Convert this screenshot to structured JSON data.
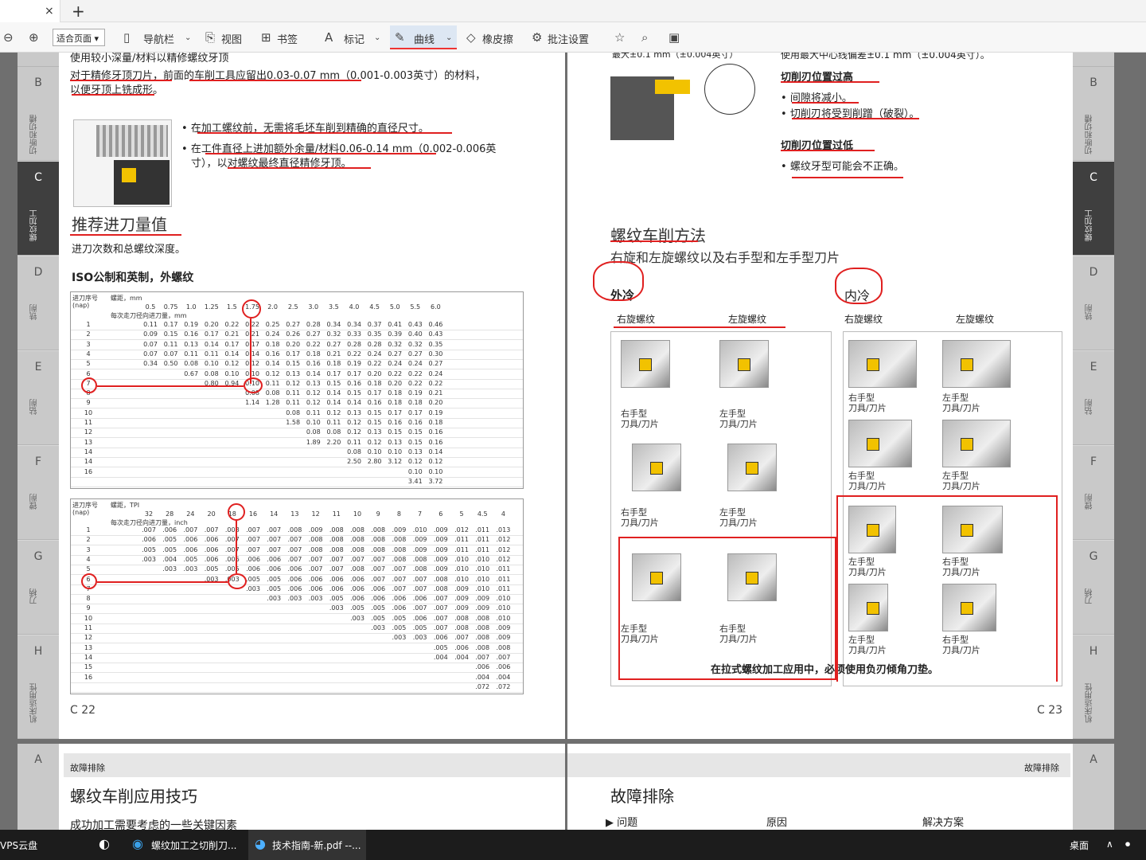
{
  "tab": {
    "close": "×",
    "new": "+"
  },
  "toolbar": {
    "zoom_out": "⊖",
    "zoom_in": "⊕",
    "zoom": "适合页面",
    "nav": "导航栏",
    "view": "视图",
    "bookmark": "书签",
    "mark": "标记",
    "curve": "曲线",
    "eraser": "橡皮擦",
    "annot": "批注设置"
  },
  "left": {
    "l1": "使用较小深量/材料以精修螺纹牙顶",
    "l2": "对于精修牙顶刀片，前面的车削工具应留出0.03-0.07 mm（0.001-0.003英寸）的材料，",
    "l3": "以便牙顶上铣成形。",
    "b1": "在加工螺纹前，无需将毛坯车削到精确的直径尺寸。",
    "b2": "在工件直径上进加额外余量/材料0.06-0.14 mm（0.002-0.006英",
    "b2b": "寸），以对螺纹最终直径精修牙顶。",
    "h1": "推荐进刀量值",
    "h1s": "进刀次数和总螺纹深度。",
    "h2": "ISO公制和英制，外螺纹",
    "t1_label": "进刀序号",
    "t1_nap": "(nap)",
    "t1_pitch": "螺距，mm",
    "t1_sub": "每次走刀径向进刀量，mm",
    "t1_cols": [
      "0.5",
      "0.75",
      "1.0",
      "1.25",
      "1.5",
      "1.75",
      "2.0",
      "2.5",
      "3.0",
      "3.5",
      "4.0",
      "4.5",
      "5.0",
      "5.5",
      "6.0"
    ],
    "t1_rows": [
      [
        "1",
        "0.11",
        "0.17",
        "0.19",
        "0.20",
        "0.22",
        "0.22",
        "0.25",
        "0.27",
        "0.28",
        "0.34",
        "0.34",
        "0.37",
        "0.41",
        "0.43",
        "0.46"
      ],
      [
        "2",
        "0.09",
        "0.15",
        "0.16",
        "0.17",
        "0.21",
        "0.21",
        "0.24",
        "0.26",
        "0.27",
        "0.32",
        "0.33",
        "0.35",
        "0.39",
        "0.40",
        "0.43"
      ],
      [
        "3",
        "0.07",
        "0.11",
        "0.13",
        "0.14",
        "0.17",
        "0.17",
        "0.18",
        "0.20",
        "0.22",
        "0.27",
        "0.28",
        "0.28",
        "0.32",
        "0.32",
        "0.35"
      ],
      [
        "4",
        "0.07",
        "0.07",
        "0.11",
        "0.11",
        "0.14",
        "0.14",
        "0.16",
        "0.17",
        "0.18",
        "0.21",
        "0.22",
        "0.24",
        "0.27",
        "0.27",
        "0.30"
      ],
      [
        "5",
        "0.34",
        "0.50",
        "0.08",
        "0.10",
        "0.12",
        "0.12",
        "0.14",
        "0.15",
        "0.16",
        "0.18",
        "0.19",
        "0.22",
        "0.24",
        "0.24",
        "0.27"
      ],
      [
        "6",
        "",
        "",
        "0.67",
        "0.08",
        "0.10",
        "0.10",
        "0.12",
        "0.13",
        "0.14",
        "0.17",
        "0.17",
        "0.20",
        "0.22",
        "0.22",
        "0.24"
      ],
      [
        "7",
        "",
        "",
        "",
        "0.80",
        "0.94",
        "0.10",
        "0.11",
        "0.12",
        "0.13",
        "0.15",
        "0.16",
        "0.18",
        "0.20",
        "0.22",
        "0.22"
      ],
      [
        "8",
        "",
        "",
        "",
        "",
        "",
        "0.08",
        "0.08",
        "0.11",
        "0.12",
        "0.14",
        "0.15",
        "0.17",
        "0.18",
        "0.19",
        "0.21"
      ],
      [
        "9",
        "",
        "",
        "",
        "",
        "",
        "1.14",
        "1.28",
        "0.11",
        "0.12",
        "0.14",
        "0.14",
        "0.16",
        "0.18",
        "0.18",
        "0.20"
      ],
      [
        "10",
        "",
        "",
        "",
        "",
        "",
        "",
        "",
        "0.08",
        "0.11",
        "0.12",
        "0.13",
        "0.15",
        "0.17",
        "0.17",
        "0.19"
      ],
      [
        "11",
        "",
        "",
        "",
        "",
        "",
        "",
        "",
        "1.58",
        "0.10",
        "0.11",
        "0.12",
        "0.15",
        "0.16",
        "0.16",
        "0.18"
      ],
      [
        "12",
        "",
        "",
        "",
        "",
        "",
        "",
        "",
        "",
        "0.08",
        "0.08",
        "0.12",
        "0.13",
        "0.15",
        "0.15",
        "0.16"
      ],
      [
        "13",
        "",
        "",
        "",
        "",
        "",
        "",
        "",
        "",
        "1.89",
        "2.20",
        "0.11",
        "0.12",
        "0.13",
        "0.15",
        "0.16"
      ],
      [
        "14",
        "",
        "",
        "",
        "",
        "",
        "",
        "",
        "",
        "",
        "",
        "0.08",
        "0.10",
        "0.10",
        "0.13",
        "0.14"
      ],
      [
        "14",
        "",
        "",
        "",
        "",
        "",
        "",
        "",
        "",
        "",
        "",
        "2.50",
        "2.80",
        "3.12",
        "0.12",
        "0.12"
      ],
      [
        "16",
        "",
        "",
        "",
        "",
        "",
        "",
        "",
        "",
        "",
        "",
        "",
        "",
        "",
        "0.10",
        "0.10"
      ],
      [
        "",
        "",
        "",
        "",
        "",
        "",
        "",
        "",
        "",
        "",
        "",
        "",
        "",
        "",
        "3.41",
        "3.72"
      ]
    ],
    "t2_pitch": "螺距，TPI",
    "t2_sub": "每次走刀径向进刀量，inch",
    "t2_cols": [
      "32",
      "28",
      "24",
      "20",
      "18",
      "16",
      "14",
      "13",
      "12",
      "11",
      "10",
      "9",
      "8",
      "7",
      "6",
      "5",
      "4.5",
      "4"
    ],
    "t2_rows": [
      [
        "1",
        ".007",
        ".006",
        ".007",
        ".007",
        ".008",
        ".007",
        ".007",
        ".008",
        ".009",
        ".008",
        ".008",
        ".008",
        ".009",
        ".010",
        ".009",
        ".012",
        ".011",
        ".013"
      ],
      [
        "2",
        ".006",
        ".005",
        ".006",
        ".006",
        ".007",
        ".007",
        ".007",
        ".007",
        ".008",
        ".008",
        ".008",
        ".008",
        ".008",
        ".009",
        ".009",
        ".011",
        ".011",
        ".012"
      ],
      [
        "3",
        ".005",
        ".005",
        ".006",
        ".006",
        ".007",
        ".007",
        ".007",
        ".007",
        ".008",
        ".008",
        ".008",
        ".008",
        ".008",
        ".009",
        ".009",
        ".011",
        ".011",
        ".012"
      ],
      [
        "4",
        ".003",
        ".004",
        ".005",
        ".006",
        ".006",
        ".006",
        ".006",
        ".007",
        ".007",
        ".007",
        ".007",
        ".007",
        ".008",
        ".008",
        ".009",
        ".010",
        ".010",
        ".012"
      ],
      [
        "5",
        "",
        ".003",
        ".003",
        ".005",
        ".005",
        ".006",
        ".006",
        ".006",
        ".007",
        ".007",
        ".008",
        ".007",
        ".007",
        ".008",
        ".009",
        ".010",
        ".010",
        ".011"
      ],
      [
        "6",
        "",
        "",
        "",
        ".003",
        ".003",
        ".005",
        ".005",
        ".006",
        ".006",
        ".006",
        ".006",
        ".007",
        ".007",
        ".007",
        ".008",
        ".010",
        ".010",
        ".011"
      ],
      [
        "7",
        "",
        "",
        "",
        "",
        "",
        ".003",
        ".005",
        ".006",
        ".006",
        ".006",
        ".006",
        ".006",
        ".007",
        ".007",
        ".008",
        ".009",
        ".010",
        ".011"
      ],
      [
        "8",
        "",
        "",
        "",
        "",
        "",
        "",
        ".003",
        ".003",
        ".003",
        ".005",
        ".006",
        ".006",
        ".006",
        ".006",
        ".007",
        ".009",
        ".009",
        ".010"
      ],
      [
        "9",
        "",
        "",
        "",
        "",
        "",
        "",
        "",
        "",
        "",
        ".003",
        ".005",
        ".005",
        ".006",
        ".007",
        ".007",
        ".009",
        ".009",
        ".010"
      ],
      [
        "10",
        "",
        "",
        "",
        "",
        "",
        "",
        "",
        "",
        "",
        "",
        ".003",
        ".005",
        ".005",
        ".006",
        ".007",
        ".008",
        ".008",
        ".010"
      ],
      [
        "11",
        "",
        "",
        "",
        "",
        "",
        "",
        "",
        "",
        "",
        "",
        "",
        ".003",
        ".005",
        ".005",
        ".007",
        ".008",
        ".008",
        ".009"
      ],
      [
        "12",
        "",
        "",
        "",
        "",
        "",
        "",
        "",
        "",
        "",
        "",
        "",
        "",
        ".003",
        ".003",
        ".006",
        ".007",
        ".008",
        ".009"
      ],
      [
        "13",
        "",
        "",
        "",
        "",
        "",
        "",
        "",
        "",
        "",
        "",
        "",
        "",
        "",
        "",
        ".005",
        ".006",
        ".008",
        ".008"
      ],
      [
        "14",
        "",
        "",
        "",
        "",
        "",
        "",
        "",
        "",
        "",
        "",
        "",
        "",
        "",
        "",
        ".004",
        ".004",
        ".007",
        ".007"
      ],
      [
        "15",
        "",
        "",
        "",
        "",
        "",
        "",
        "",
        "",
        "",
        "",
        "",
        "",
        "",
        "",
        "",
        "",
        ".006",
        ".006"
      ],
      [
        "16",
        "",
        "",
        "",
        "",
        "",
        "",
        "",
        "",
        "",
        "",
        "",
        "",
        "",
        "",
        "",
        "",
        ".004",
        ".004"
      ],
      [
        "",
        "",
        "",
        "",
        "",
        "",
        "",
        "",
        "",
        "",
        "",
        "",
        "",
        "",
        "",
        "",
        "",
        ".072",
        ".072"
      ]
    ],
    "pn": "C 22"
  },
  "right": {
    "top": "最大±0.1 mm（±0.004英寸）",
    "top2": "使用最大中心线偏差±0.1 mm（±0.004英寸）。",
    "hi": "切削刃位置过高",
    "hi1": "间隙将减小。",
    "hi2": "切削刃将受到削蹭（破裂）。",
    "lo": "切削刃位置过低",
    "lo1": "螺纹牙型可能会不正确。",
    "h1": "螺纹车削方法",
    "h1s": "右旋和左旋螺纹以及右手型和左手型刀片",
    "ext": "外冷",
    "int": "内冷",
    "rt": "右旋螺纹",
    "lt": "左旋螺纹",
    "rt2": "右旋螺纹",
    "lt2": "左旋螺纹",
    "capR": "右手型",
    "capL": "左手型",
    "capT": "刀具/刀片",
    "note": "在拉式螺纹加工应用中，必须使用负刃倾角刀垫。",
    "pn": "C 23"
  },
  "bottom": {
    "lh": "故障排除",
    "lt": "螺纹车削应用技巧",
    "ls": "成功加工需要考虑的一些关键因素",
    "rh": "故障排除",
    "rt": "故障排除",
    "c1": "问题",
    "c2": "原因",
    "c3": "解决方案"
  },
  "sidetabs": {
    "B": "B",
    "C": "C",
    "D": "D",
    "E": "E",
    "F": "F",
    "G": "G",
    "H": "H",
    "A": "A",
    "vb": "切断和切槽",
    "vc": "螺纹加工",
    "vd": "铣削",
    "ve": "钻削",
    "vf": "镗削",
    "vg": "刀柄",
    "vh": "机床适用性",
    "top": "车"
  },
  "taskbar": {
    "vps": "VPS云盘",
    "edge": "螺纹加工之切削刀...",
    "pdf": "技术指南-新.pdf --...",
    "desktop": "桌面"
  }
}
